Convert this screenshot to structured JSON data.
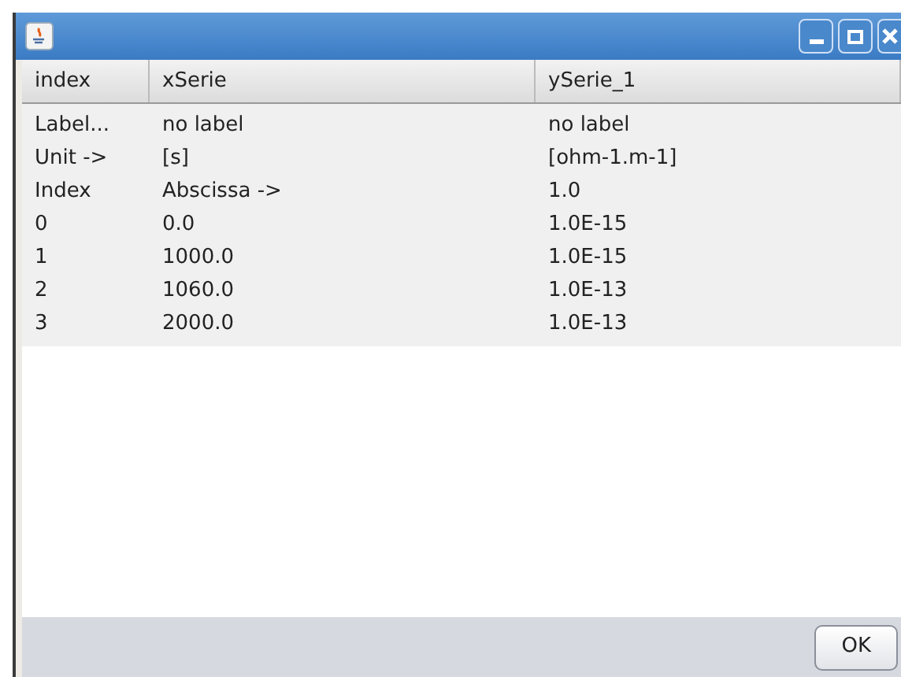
{
  "table": {
    "columns": [
      "index",
      "xSerie",
      "ySerie_1"
    ],
    "rows": [
      [
        "Label...",
        "no label",
        "no label"
      ],
      [
        "Unit ->",
        "[s]",
        "[ohm-1.m-1]"
      ],
      [
        "Index",
        "Abscissa ->",
        "1.0"
      ],
      [
        "0",
        "0.0",
        "1.0E-15"
      ],
      [
        "1",
        "1000.0",
        "1.0E-15"
      ],
      [
        "2",
        "1060.0",
        "1.0E-13"
      ],
      [
        "3",
        "2000.0",
        "1.0E-13"
      ]
    ]
  },
  "buttons": [
    "OK"
  ]
}
